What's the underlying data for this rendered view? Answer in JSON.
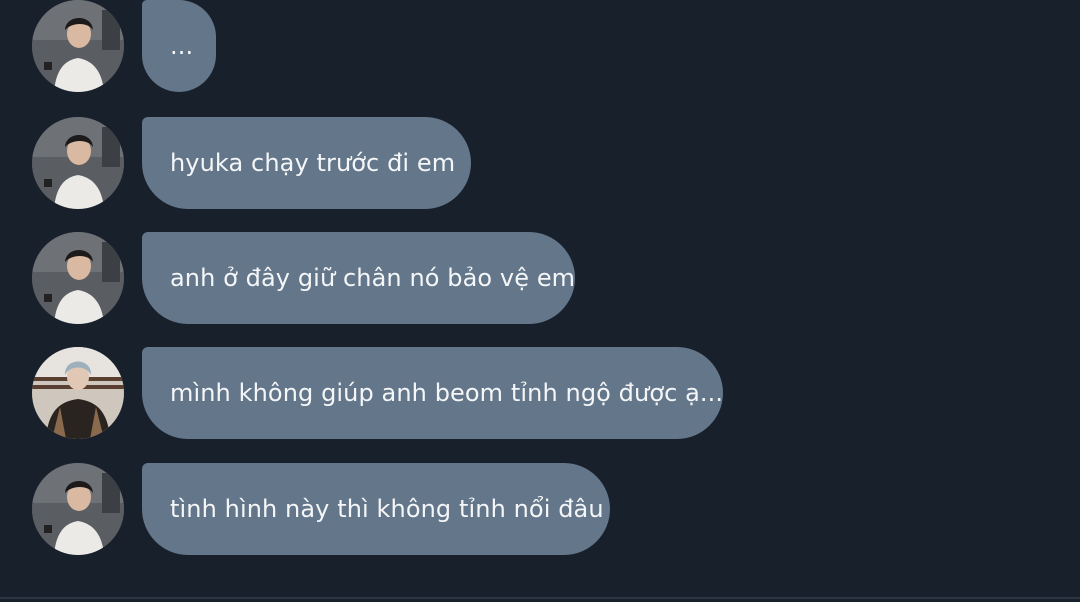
{
  "messages": [
    {
      "avatar": "avatar-boy-white-shirt",
      "text": "..."
    },
    {
      "avatar": "avatar-boy-white-shirt",
      "text": "hyuka chạy trước đi em"
    },
    {
      "avatar": "avatar-boy-white-shirt",
      "text": "anh ở đây giữ chân nó bảo vệ em"
    },
    {
      "avatar": "avatar-boy-plaid-shirt",
      "text": "mình không giúp anh beom tỉnh ngộ được ạ..."
    },
    {
      "avatar": "avatar-boy-white-shirt",
      "text": "tình hình này thì không tỉnh nổi đâu"
    }
  ],
  "colors": {
    "background": "#18202b",
    "bubble": "#64768a",
    "text": "#f4f6f8"
  }
}
